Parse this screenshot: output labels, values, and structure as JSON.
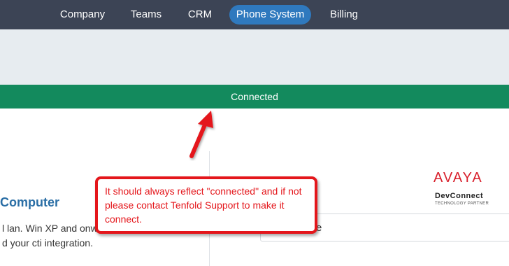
{
  "nav": {
    "items": [
      {
        "label": "Company"
      },
      {
        "label": "Teams"
      },
      {
        "label": "CRM"
      },
      {
        "label": "Phone System",
        "active": true
      },
      {
        "label": "Billing"
      }
    ]
  },
  "status": {
    "label": "Connected"
  },
  "left_panel": {
    "heading": "Computer",
    "line1": "l lan. Win XP and onwa",
    "line2": "d your cti integration."
  },
  "right_panel": {
    "input_value": "fice",
    "logo_avaya": "AVAYA",
    "logo_devconnect": "DevConnect",
    "logo_tagline": "TECHNOLOGY PARTNER"
  },
  "annotation": {
    "text": "It should always reflect \"connected\" and if not please contact Tenfold Support to make it connect."
  },
  "colors": {
    "nav_bg": "#3c4455",
    "nav_active": "#2f79be",
    "status_bg": "#138a5d",
    "annotation_red": "#e4161b",
    "heading_blue": "#2a6ea5"
  }
}
